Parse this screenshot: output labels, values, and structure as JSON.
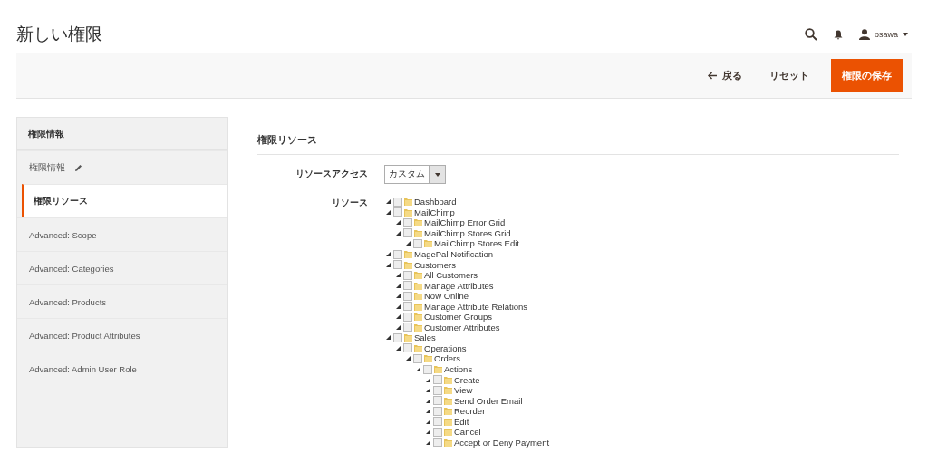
{
  "page_title": "新しい権限",
  "header": {
    "username": "osawa"
  },
  "actions": {
    "back": "戻る",
    "reset": "リセット",
    "save": "権限の保存"
  },
  "sidebar": {
    "title": "権限情報",
    "items": [
      {
        "label": "権限情報",
        "selected": false,
        "editable": true
      },
      {
        "label": "権限リソース",
        "selected": true,
        "editable": false
      },
      {
        "label": "Advanced: Scope",
        "selected": false,
        "editable": false
      },
      {
        "label": "Advanced: Categories",
        "selected": false,
        "editable": false
      },
      {
        "label": "Advanced: Products",
        "selected": false,
        "editable": false
      },
      {
        "label": "Advanced: Product Attributes",
        "selected": false,
        "editable": false
      },
      {
        "label": "Advanced: Admin User Role",
        "selected": false,
        "editable": false
      }
    ]
  },
  "section": {
    "title": "権限リソース",
    "access_label": "リソースアクセス",
    "access_value": "カスタム",
    "resources_label": "リソース"
  },
  "tree": [
    {
      "label": "Dashboard",
      "checked": false
    },
    {
      "label": "MailChimp",
      "checked": false,
      "children": [
        {
          "label": "MailChimp Error Grid",
          "checked": false
        },
        {
          "label": "MailChimp Stores Grid",
          "checked": false,
          "children": [
            {
              "label": "MailChimp Stores Edit",
              "checked": false
            }
          ]
        }
      ]
    },
    {
      "label": "MagePal Notification",
      "checked": false
    },
    {
      "label": "Customers",
      "checked": false,
      "children": [
        {
          "label": "All Customers",
          "checked": false
        },
        {
          "label": "Manage Attributes",
          "checked": false
        },
        {
          "label": "Now Online",
          "checked": false
        },
        {
          "label": "Manage Attribute Relations",
          "checked": false
        },
        {
          "label": "Customer Groups",
          "checked": false
        },
        {
          "label": "Customer Attributes",
          "checked": false
        }
      ]
    },
    {
      "label": "Sales",
      "checked": false,
      "children": [
        {
          "label": "Operations",
          "checked": false,
          "children": [
            {
              "label": "Orders",
              "checked": false,
              "children": [
                {
                  "label": "Actions",
                  "checked": false,
                  "children": [
                    {
                      "label": "Create",
                      "checked": false
                    },
                    {
                      "label": "View",
                      "checked": false
                    },
                    {
                      "label": "Send Order Email",
                      "checked": false
                    },
                    {
                      "label": "Reorder",
                      "checked": false
                    },
                    {
                      "label": "Edit",
                      "checked": false
                    },
                    {
                      "label": "Cancel",
                      "checked": false
                    },
                    {
                      "label": "Accept or Deny Payment",
                      "checked": false
                    }
                  ]
                }
              ]
            }
          ]
        }
      ]
    }
  ]
}
